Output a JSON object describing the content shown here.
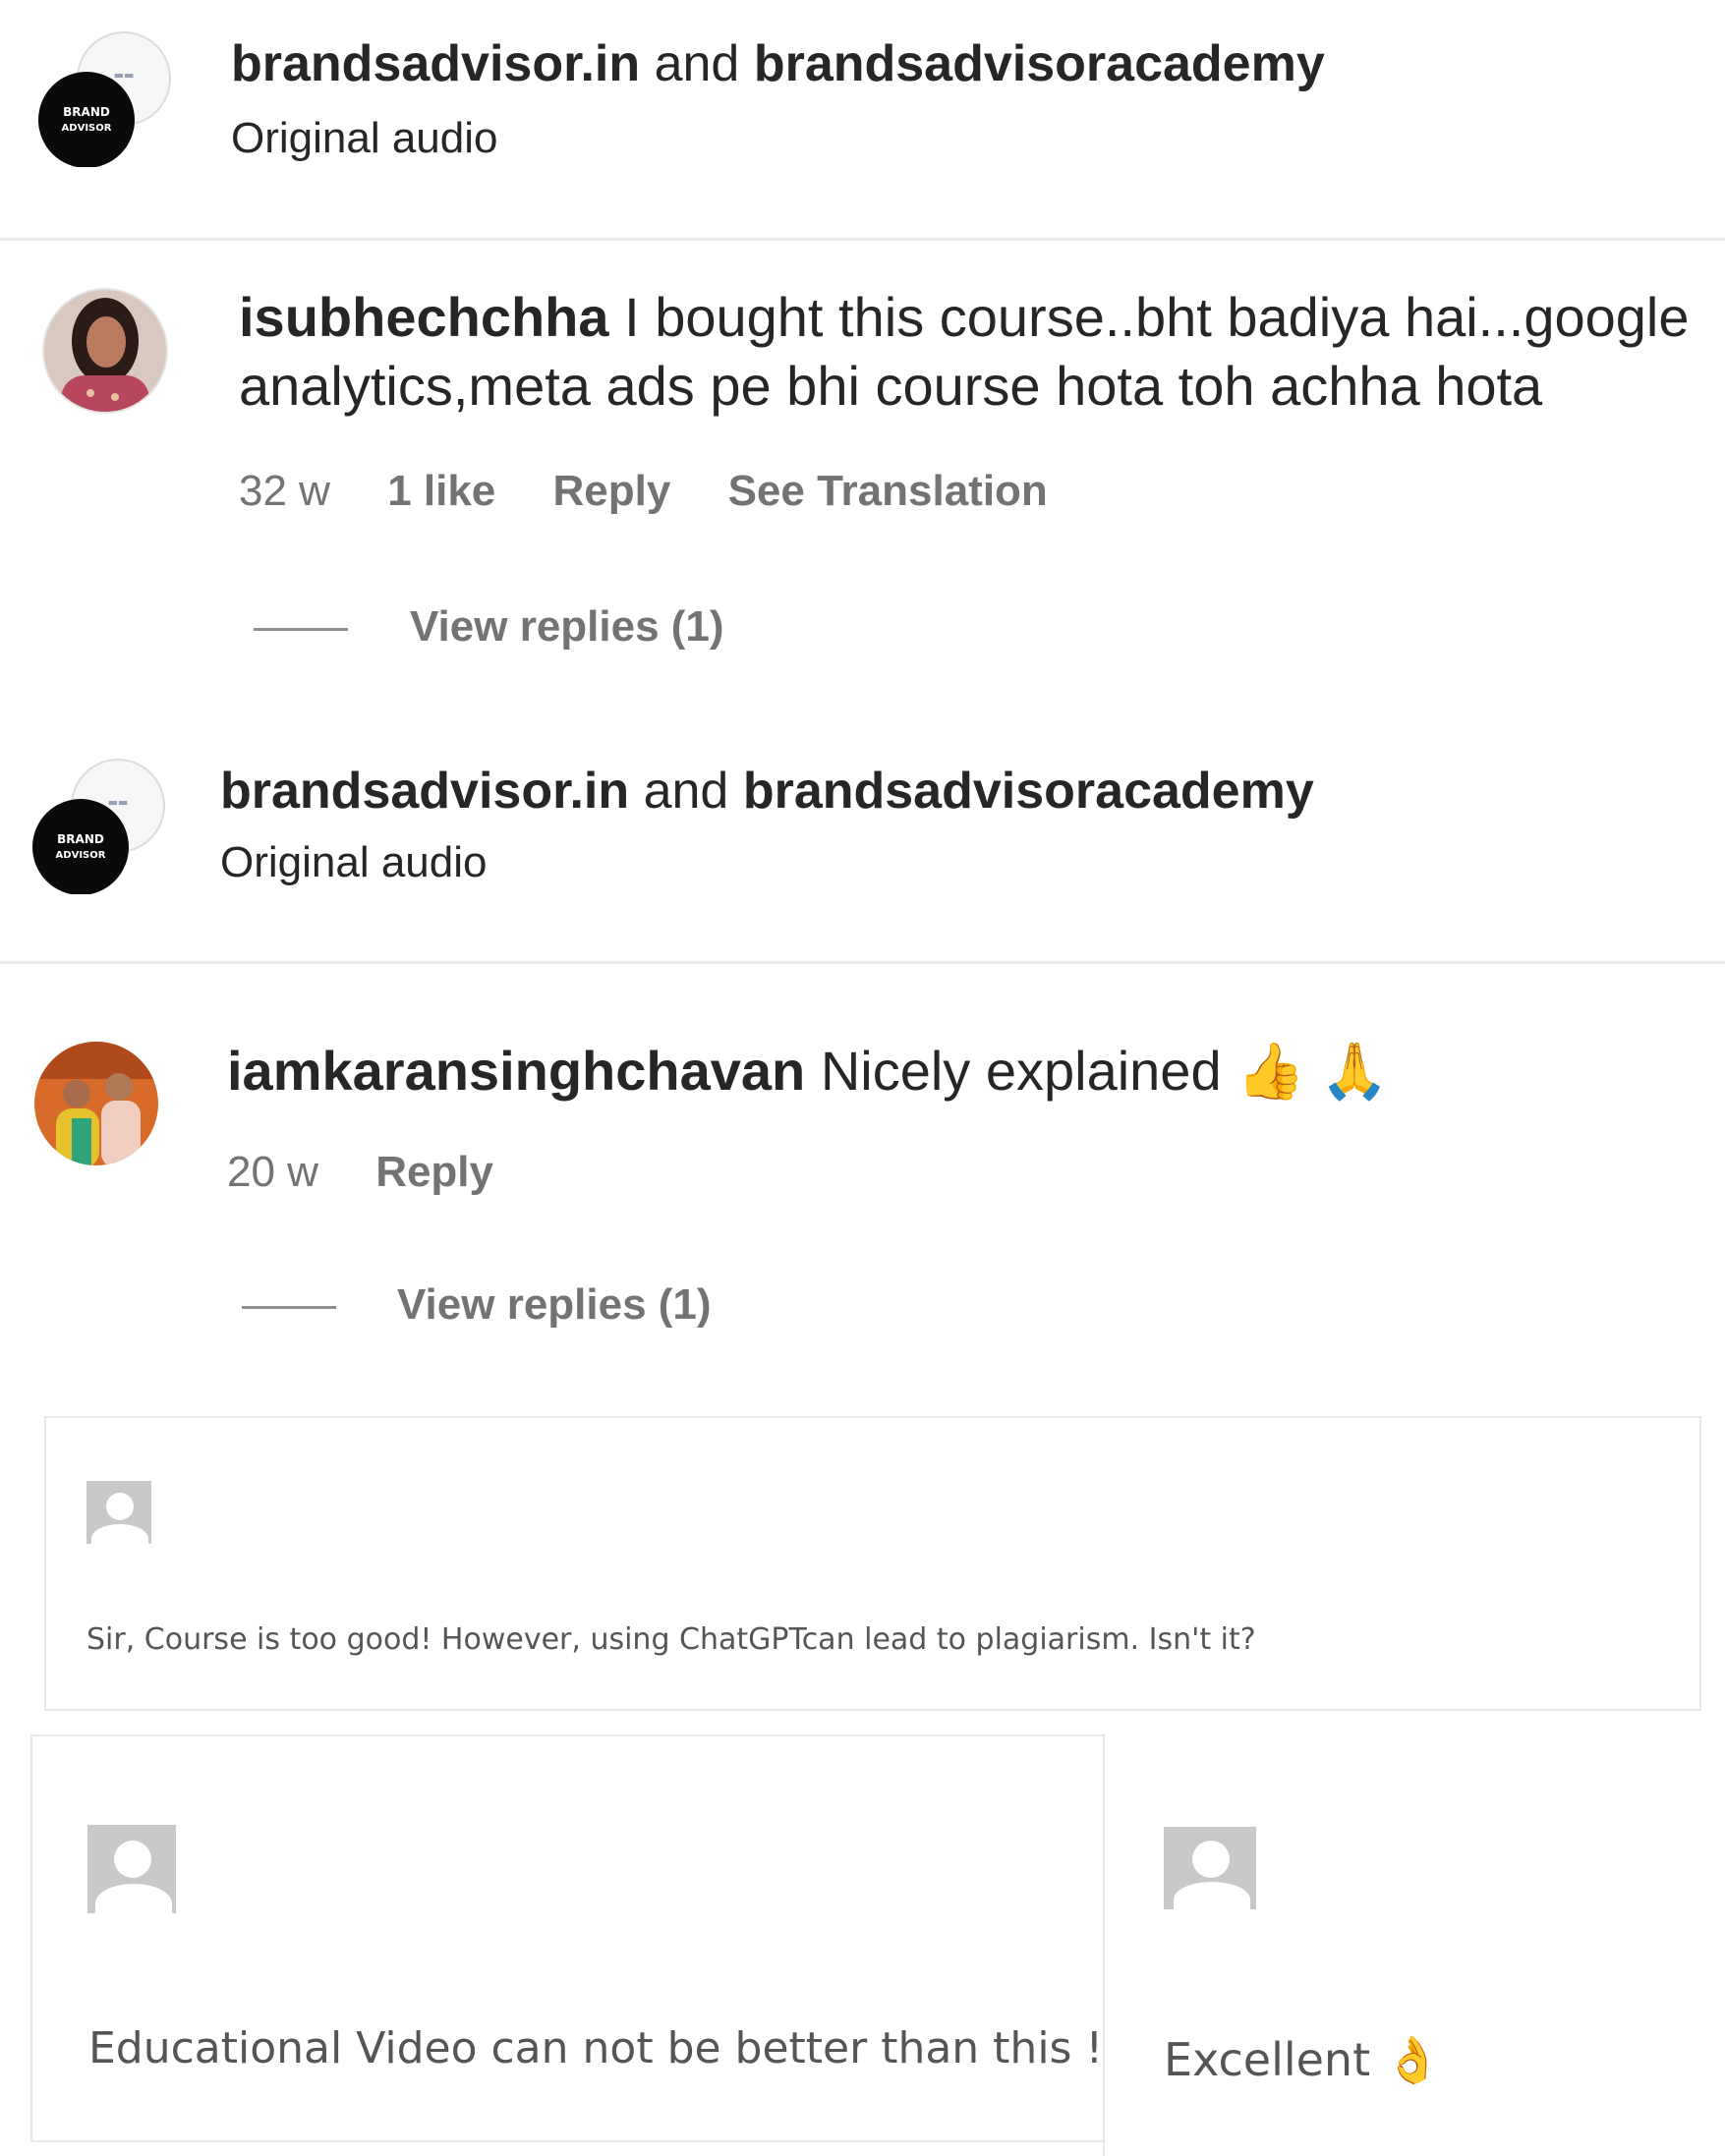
{
  "thread1": {
    "audio": {
      "account1": "brandsadvisor.in",
      "joiner": "and",
      "account2": "brandsadvisoracademy",
      "subtitle": "Original audio",
      "logo_text": "BRAND ADVISOR"
    },
    "comment": {
      "username": "isubhechchha",
      "text": "I bought this course..bht badiya hai...google analytics,meta ads pe bhi course hota toh achha hota",
      "time": "32 w",
      "likes": "1 like",
      "reply": "Reply",
      "translation": "See Translation",
      "view_replies": "View replies (1)"
    }
  },
  "thread2": {
    "audio": {
      "account1": "brandsadvisor.in",
      "joiner": "and",
      "account2": "brandsadvisoracademy",
      "subtitle": "Original audio",
      "logo_text": "BRAND ADVISOR"
    },
    "comment": {
      "username": "iamkaransinghchavan",
      "text": "Nicely explained 👍 🙏",
      "time": "20 w",
      "reply": "Reply",
      "view_replies": "View replies (1)"
    }
  },
  "blog_comments": [
    {
      "text": "Sir, Course is too good! However, using ChatGPTcan lead to plagiarism. Isn't it?"
    },
    {
      "text": "Educational Video can not be better than this !"
    },
    {
      "text": "Excellent 👌"
    }
  ],
  "colors": {
    "text_primary": "#262626",
    "text_secondary": "#737373",
    "divider": "#ececec",
    "box_border": "#e9e9e9",
    "avatar_placeholder": "#c9c9c9"
  }
}
